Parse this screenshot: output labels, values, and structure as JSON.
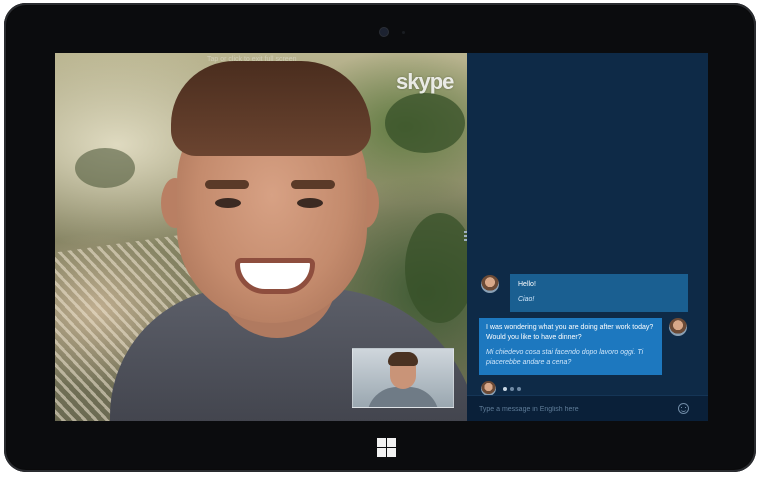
{
  "app": {
    "name": "skype"
  },
  "video": {
    "hint": "Tap or click to exit full screen"
  },
  "chat": {
    "messages": [
      {
        "from": "contact",
        "original": "Hello!",
        "translation": "Ciao!"
      },
      {
        "from": "self",
        "original": "I was wondering what you are doing after work today? Would you like to have dinner?",
        "translation": "Mi chiedevo cosa stai facendo dopo lavoro oggi. Ti piacerebbe andare a cena?"
      }
    ],
    "typing_indicator": "typing-dots-icon"
  },
  "input": {
    "placeholder": "Type a message in English here",
    "value": ""
  },
  "icons": {
    "emoji": "emoji-smiley-icon",
    "windows": "windows-logo-icon",
    "camera": "front-camera-icon"
  },
  "colors": {
    "chat_background": "#0e2a47",
    "incoming_bubble": "#1a5f91",
    "outgoing_bubble": "#1d78bf",
    "bezel": "#0b0c0e"
  }
}
